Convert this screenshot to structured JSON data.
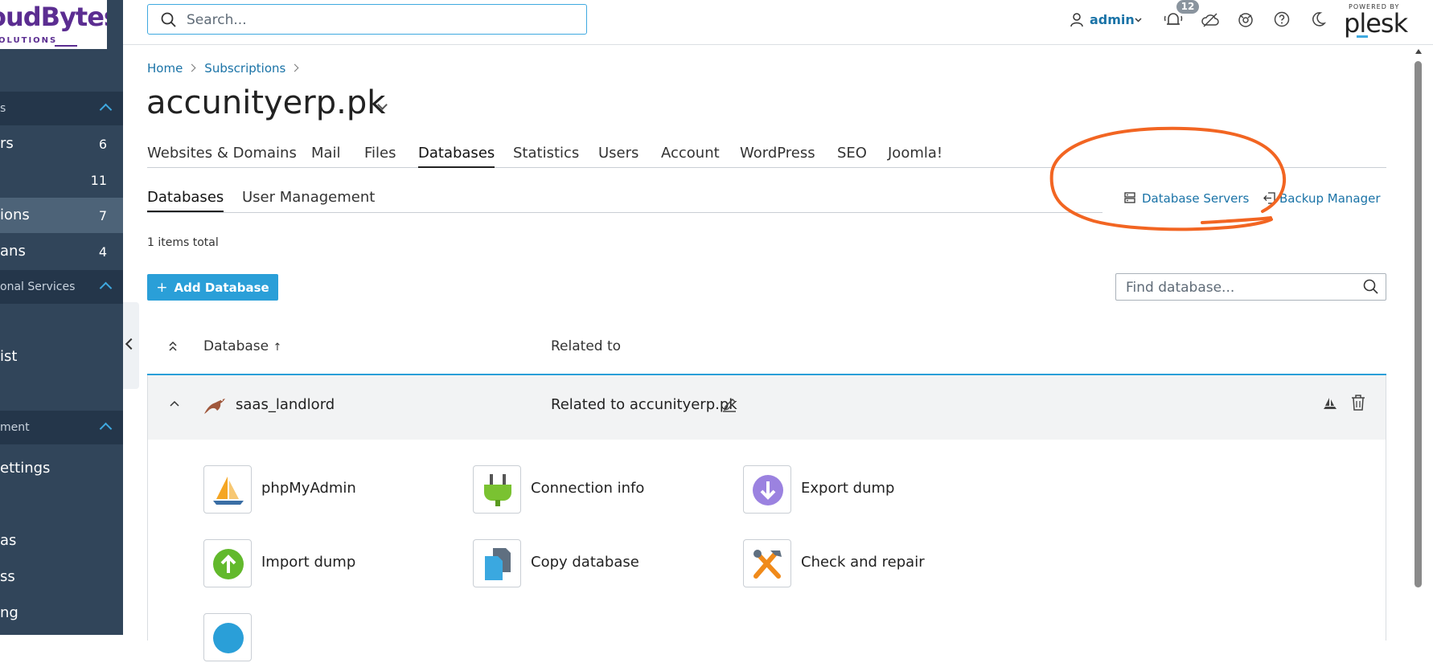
{
  "sidebar": {
    "logo_main": "oudBytes",
    "logo_sub": "OLUTIONS",
    "sections": [
      {
        "label": "s"
      },
      {
        "label": "onal Services"
      },
      {
        "label": "ment"
      }
    ],
    "items": [
      {
        "label": "rs",
        "count": "6"
      },
      {
        "label": "",
        "count": "11"
      },
      {
        "label": "ions",
        "count": "7"
      },
      {
        "label": "ans",
        "count": "4"
      },
      {
        "label": "ist",
        "count": ""
      },
      {
        "label": "ettings",
        "count": ""
      },
      {
        "label": "as",
        "count": ""
      },
      {
        "label": "ss",
        "count": ""
      },
      {
        "label": "ng",
        "count": ""
      }
    ]
  },
  "header": {
    "search_placeholder": "Search...",
    "user": "admin",
    "notifications": "12",
    "powered_by": "POWERED BY",
    "brand": "plesk"
  },
  "breadcrumb": [
    "Home",
    "Subscriptions"
  ],
  "page_title": "accunityerp.pk",
  "tabs": [
    "Websites & Domains",
    "Mail",
    "Files",
    "Databases",
    "Statistics",
    "Users",
    "Account",
    "WordPress",
    "SEO",
    "Joomla!"
  ],
  "active_tab": "Databases",
  "subtabs": [
    "Databases",
    "User Management"
  ],
  "tool_links": {
    "db_servers": "Database Servers",
    "backup": "Backup Manager"
  },
  "items_total": "1 items total",
  "add_button": "Add Database",
  "find_placeholder": "Find database...",
  "table": {
    "col_database": "Database",
    "col_related": "Related to",
    "row": {
      "name": "saas_landlord",
      "related": "Related to accunityerp.pk"
    }
  },
  "tools": [
    "phpMyAdmin",
    "Connection info",
    "Export dump",
    "Import dump",
    "Copy database",
    "Check and repair"
  ],
  "colors": {
    "accent": "#2a9fd8",
    "link": "#1a73a7",
    "sidebar": "#31455a",
    "annotation": "#f26522"
  }
}
